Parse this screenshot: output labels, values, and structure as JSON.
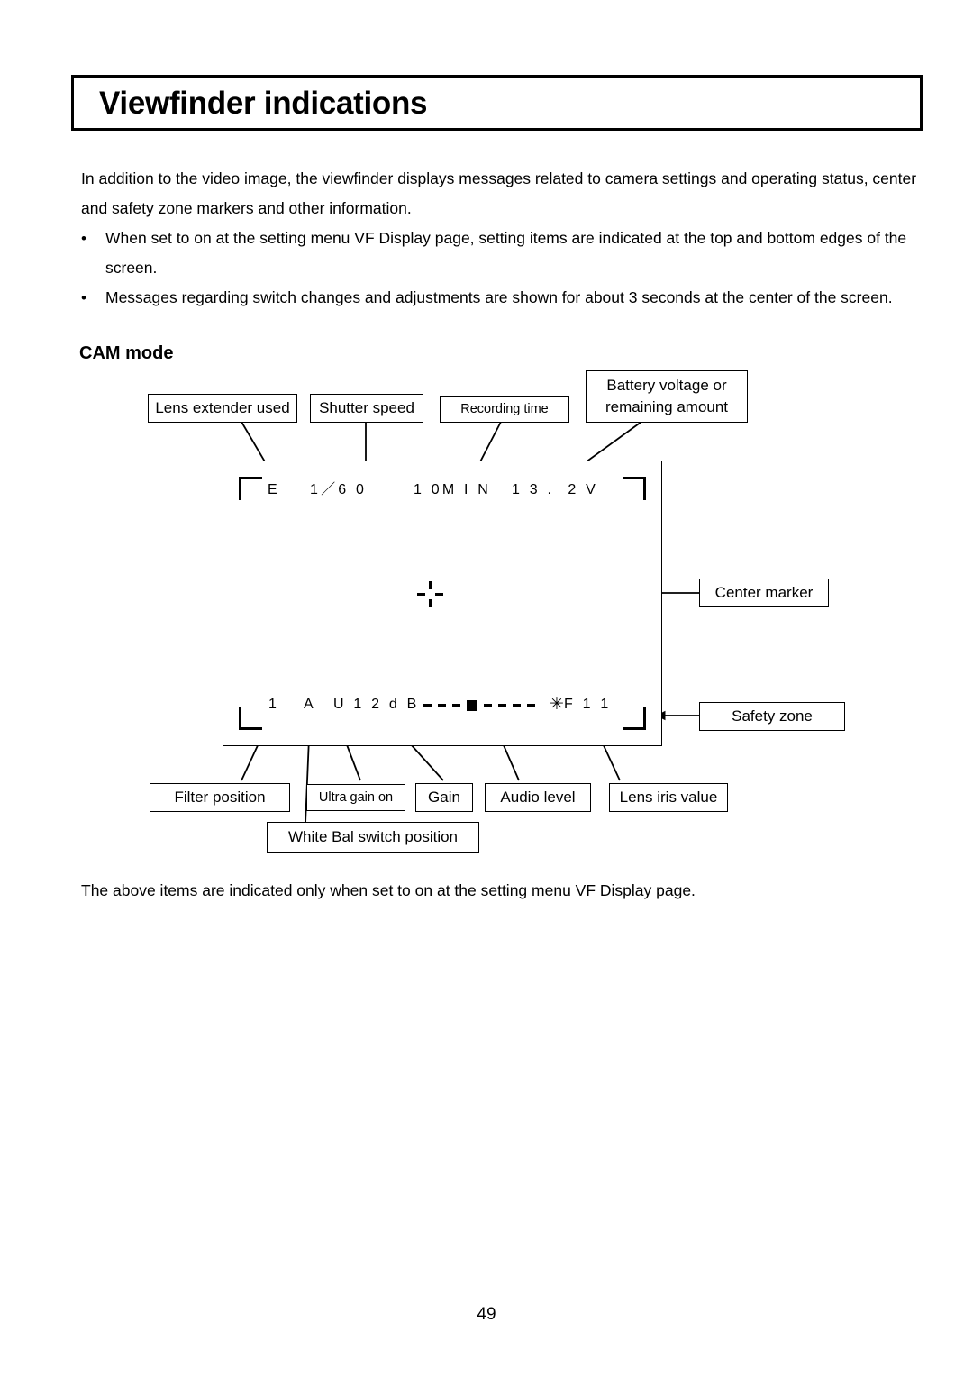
{
  "page": {
    "title": "Viewfinder indications",
    "number": "49"
  },
  "intro": {
    "paragraph": "In addition to the video image, the viewfinder displays messages related to camera settings and operating status, center and safety zone markers and other information.",
    "bullet_marker": "•",
    "bullets": [
      "When set to on at the setting menu VF Display page, setting items are indicated at the top and bottom edges of the screen.",
      "Messages regarding switch changes and adjustments are shown for about 3 seconds at the center of the screen."
    ]
  },
  "section": {
    "heading": "CAM mode"
  },
  "viewfinder": {
    "top_line": {
      "extender": "E",
      "shutter_speed": "1／6 0",
      "recording_time": "1 0M I N",
      "battery": "1 3 .  2 V"
    },
    "bottom_line": {
      "filter_position": "1",
      "white_bal_position": "A",
      "gain": "U 1 2 d B",
      "iris_value": "F 1 1"
    },
    "audio_meter": {
      "dashes_before": 3,
      "marker": "■",
      "dashes_after": 4,
      "peak_symbol": "✳"
    },
    "center_marker_label": "center-marker"
  },
  "callouts": {
    "lens_extender": "Lens extender used",
    "shutter_speed": "Shutter speed",
    "recording_time": "Recording time",
    "battery": "Battery voltage or remaining amount",
    "center_marker": "Center marker",
    "safety_zone": "Safety zone",
    "filter_position": "Filter position",
    "ultra_gain": "Ultra gain on",
    "gain": "Gain",
    "audio_level": "Audio level",
    "lens_iris": "Lens iris value",
    "white_bal": "White Bal switch position"
  },
  "closing": {
    "text": "The above items are indicated only when set to on at the setting menu VF Display page."
  }
}
